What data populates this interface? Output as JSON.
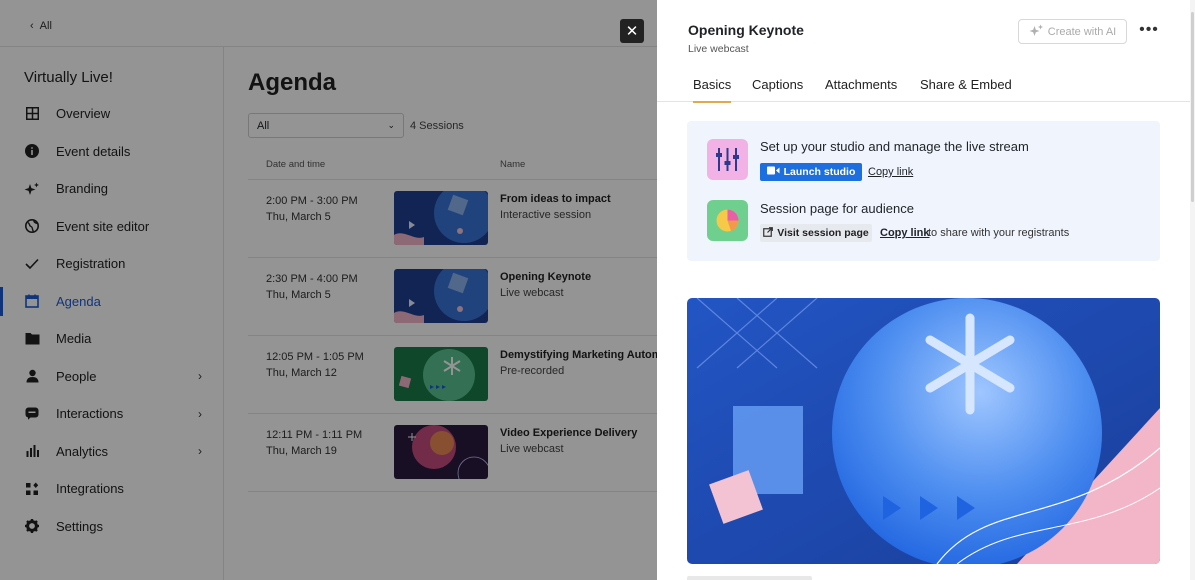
{
  "topbar": {
    "back_label": "All"
  },
  "sidebar": {
    "event_name": "Virtually Live!",
    "items": [
      {
        "label": "Overview",
        "icon": "grid-icon",
        "has_chevron": false,
        "active": false
      },
      {
        "label": "Event details",
        "icon": "info-icon",
        "has_chevron": false,
        "active": false
      },
      {
        "label": "Branding",
        "icon": "sparkle-icon",
        "has_chevron": false,
        "active": false
      },
      {
        "label": "Event site editor",
        "icon": "globe-icon",
        "has_chevron": false,
        "active": false
      },
      {
        "label": "Registration",
        "icon": "check-icon",
        "has_chevron": false,
        "active": false
      },
      {
        "label": "Agenda",
        "icon": "calendar-icon",
        "has_chevron": false,
        "active": true
      },
      {
        "label": "Media",
        "icon": "folder-icon",
        "has_chevron": false,
        "active": false
      },
      {
        "label": "People",
        "icon": "person-icon",
        "has_chevron": true,
        "active": false
      },
      {
        "label": "Interactions",
        "icon": "chat-icon",
        "has_chevron": true,
        "active": false
      },
      {
        "label": "Analytics",
        "icon": "bar-chart-icon",
        "has_chevron": true,
        "active": false
      },
      {
        "label": "Integrations",
        "icon": "integrations-icon",
        "has_chevron": false,
        "active": false
      },
      {
        "label": "Settings",
        "icon": "gear-icon",
        "has_chevron": false,
        "active": false
      }
    ],
    "accent_color": "#1d5bd6"
  },
  "agenda": {
    "title": "Agenda",
    "filter_value": "All",
    "session_count": "4 Sessions",
    "columns": {
      "date": "Date and time",
      "name": "Name"
    },
    "rows": [
      {
        "time": "2:00 PM - 3:00 PM",
        "date": "Thu, March 5",
        "name": "From ideas to impact",
        "type": "Interactive session",
        "thumb": "blue-abstract"
      },
      {
        "time": "2:30 PM - 4:00 PM",
        "date": "Thu, March 5",
        "name": "Opening Keynote",
        "type": "Live webcast",
        "thumb": "blue-abstract"
      },
      {
        "time": "12:05 PM - 1:05 PM",
        "date": "Thu, March 12",
        "name": "Demystifying Marketing Automa",
        "type": "Pre-recorded",
        "thumb": "green-abstract"
      },
      {
        "time": "12:11 PM - 1:11 PM",
        "date": "Thu, March 19",
        "name": "Video Experience Delivery",
        "type": "Live webcast",
        "thumb": "dark-abstract"
      }
    ]
  },
  "drawer": {
    "title": "Opening Keynote",
    "subtitle": "Live webcast",
    "ai_button": "Create with AI",
    "more_label": "•••",
    "tabs": [
      "Basics",
      "Captions",
      "Attachments",
      "Share & Embed"
    ],
    "active_tab": "Basics",
    "tab_accent": "#e1a94a",
    "studio": {
      "heading": "Set up your studio and manage the live stream",
      "launch_label": "Launch studio",
      "copy_link": "Copy link"
    },
    "audience": {
      "heading": "Session page for audience",
      "visit_label": "Visit session page",
      "copy_link": "Copy link",
      "share_text": "to share with your registrants"
    },
    "primary_color": "#1d6fe0"
  }
}
